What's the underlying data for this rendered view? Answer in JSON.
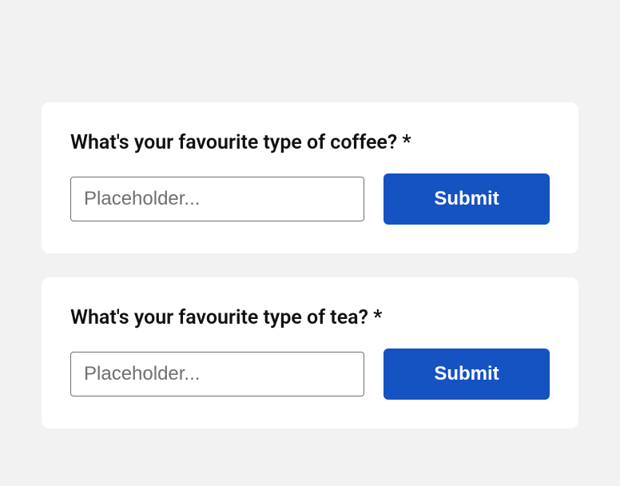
{
  "forms": [
    {
      "label": "What's your favourite type of coffee? *",
      "placeholder": "Placeholder...",
      "submit": "Submit"
    },
    {
      "label": "What's your favourite type of tea? *",
      "placeholder": "Placeholder...",
      "submit": "Submit"
    }
  ]
}
